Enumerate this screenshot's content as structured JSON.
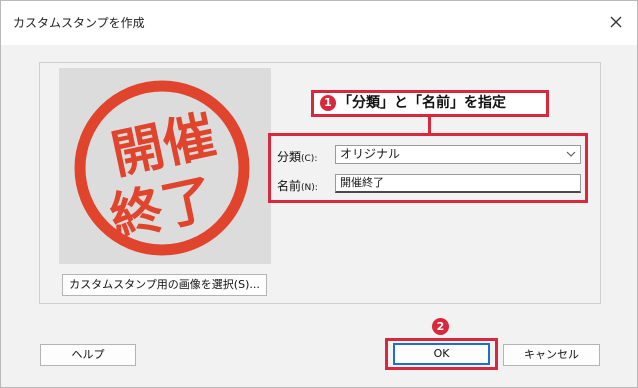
{
  "window": {
    "title": "カスタムスタンプを作成",
    "close_icon": "close-icon"
  },
  "preview": {
    "stamp_text_line1": "開催",
    "stamp_text_line2": "終了",
    "stamp_color": "#e0442c"
  },
  "buttons": {
    "select_image": "カスタムスタンプ用の画像を選択(S)...",
    "help": "ヘルプ",
    "ok": "OK",
    "cancel": "キャンセル"
  },
  "annotations": {
    "callout1_number": "❶",
    "callout1_text": "「分類」と「名前」を指定",
    "callout2_number": "❷",
    "accent_color": "#d7283c"
  },
  "fields": {
    "category_label": "分類",
    "category_shortcut": "(C):",
    "category_value": "オリジナル",
    "name_label": "名前",
    "name_shortcut": "(N):",
    "name_value": "開催終了"
  }
}
